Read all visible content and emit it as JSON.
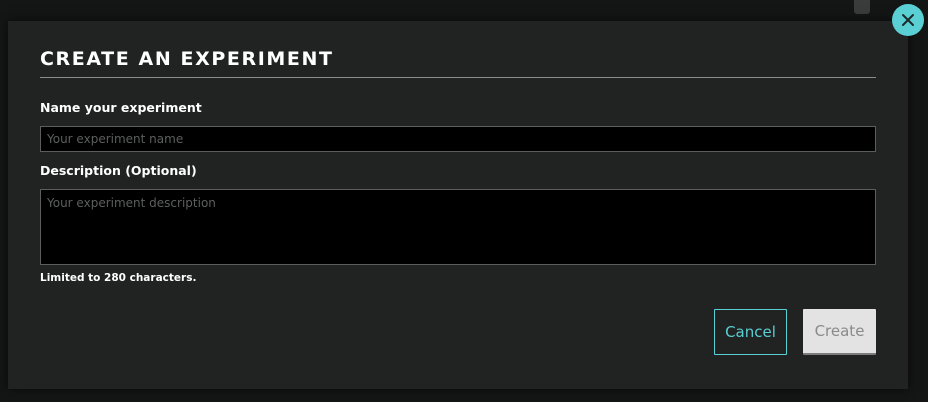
{
  "modal": {
    "title": "CREATE AN EXPERIMENT",
    "name_label": "Name your experiment",
    "name_placeholder": "Your experiment name",
    "name_value": "",
    "description_label": "Description (Optional)",
    "description_placeholder": "Your experiment description",
    "description_value": "",
    "limit_text": "Limited to 280 characters.",
    "cancel_label": "Cancel",
    "create_label": "Create",
    "close_icon": "close-icon"
  },
  "colors": {
    "accent": "#5ad0d4",
    "modal_background": "#212322",
    "page_background": "#141515",
    "input_background": "#000000",
    "create_button_background": "#e3e3e3"
  }
}
